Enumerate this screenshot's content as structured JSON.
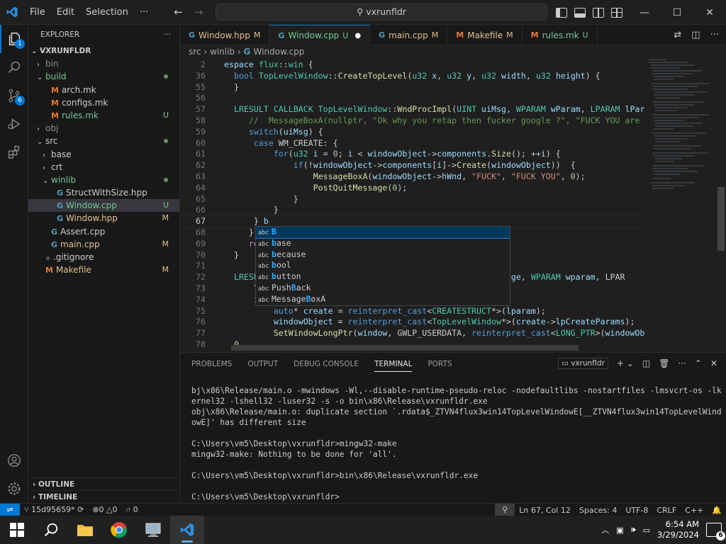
{
  "app": {
    "menu": [
      "File",
      "Edit",
      "Selection"
    ],
    "more": "···",
    "search": "vxrunfldr",
    "accent": "#0078d4"
  },
  "activity": {
    "explorer_badge": "1"
  },
  "explorer": {
    "title": "EXPLORER",
    "root": "VXRUNFLDR",
    "items": [
      {
        "label": "bin",
        "depth": 1,
        "chev": "›",
        "cls": "dim",
        "mark": ""
      },
      {
        "label": "build",
        "depth": 1,
        "chev": "⌄",
        "cls": "u-color",
        "mark": "dot"
      },
      {
        "label": "arch.mk",
        "depth": 2,
        "chev": "",
        "cls": "",
        "mark": "",
        "icon": "M"
      },
      {
        "label": "configs.mk",
        "depth": 2,
        "chev": "",
        "cls": "",
        "mark": "",
        "icon": "M"
      },
      {
        "label": "rules.mk",
        "depth": 2,
        "chev": "",
        "cls": "u-color",
        "mark": "U",
        "icon": "M"
      },
      {
        "label": "obj",
        "depth": 1,
        "chev": "›",
        "cls": "dim",
        "mark": ""
      },
      {
        "label": "src",
        "depth": 1,
        "chev": "⌄",
        "cls": "",
        "mark": "dot"
      },
      {
        "label": "base",
        "depth": 2,
        "chev": "›",
        "cls": "",
        "mark": ""
      },
      {
        "label": "crt",
        "depth": 2,
        "chev": "›",
        "cls": "",
        "mark": ""
      },
      {
        "label": "winlib",
        "depth": 2,
        "chev": "⌄",
        "cls": "u-color",
        "mark": "dot"
      },
      {
        "label": "StructWithSize.hpp",
        "depth": 3,
        "chev": "",
        "cls": "",
        "mark": "",
        "icon": "C"
      },
      {
        "label": "Window.cpp",
        "depth": 3,
        "chev": "",
        "cls": "u-color",
        "mark": "U",
        "icon": "C",
        "sel": true
      },
      {
        "label": "Window.hpp",
        "depth": 3,
        "chev": "",
        "cls": "m-color",
        "mark": "M",
        "icon": "C"
      },
      {
        "label": "Assert.cpp",
        "depth": 2,
        "chev": "",
        "cls": "",
        "mark": "",
        "icon": "C"
      },
      {
        "label": "main.cpp",
        "depth": 2,
        "chev": "",
        "cls": "m-color",
        "mark": "M",
        "icon": "C"
      },
      {
        "label": ".gitignore",
        "depth": 1,
        "chev": "",
        "cls": "",
        "mark": "",
        "icon": "◆"
      },
      {
        "label": "Makefile",
        "depth": 1,
        "chev": "",
        "cls": "m-color",
        "mark": "M",
        "icon": "M"
      }
    ],
    "outline": "OUTLINE",
    "timeline": "TIMELINE"
  },
  "tabs": [
    {
      "label": "Window.hpp",
      "mark": "M",
      "icon": "C"
    },
    {
      "label": "Window.cpp",
      "mark": "U",
      "icon": "C",
      "active": true
    },
    {
      "label": "main.cpp",
      "mark": "M",
      "icon": "C"
    },
    {
      "label": "Makefile",
      "mark": "M",
      "icon": "M"
    },
    {
      "label": "rules.mk",
      "mark": "U",
      "icon": "M"
    }
  ],
  "breadcrumb": {
    "a": "src",
    "b": "winlib",
    "c": "Window.cpp"
  },
  "editor": {
    "lines": [
      {
        "n": "2",
        "t": "espace flux::win {"
      },
      {
        "n": "36",
        "t": "  bool TopLevelWindow::CreateTopLevel(u32 x, u32 y, u32 width, u32 height) {"
      },
      {
        "n": "55",
        "t": "  }"
      },
      {
        "n": "56",
        "t": ""
      },
      {
        "n": "57",
        "t": "  LRESULT CALLBACK TopLevelWindow::WndProcImpl(UINT uiMsg, WPARAM wParam, LPARAM lParam) {"
      },
      {
        "n": "58",
        "t": "     //  MessageBoxA(nullptr, \"Ok why you retap then fucker google ?\", \"FUCK YOU are fuckest go"
      },
      {
        "n": "59",
        "t": "     switch(uiMsg) {"
      },
      {
        "n": "60",
        "t": "      case WM_CREATE: {"
      },
      {
        "n": "61",
        "t": "          for(u32 i = 0; i < windowObject->components.Size(); ++i) {"
      },
      {
        "n": "62",
        "t": "              if(!windowObject->components[i]->Create(windowObject))  {"
      },
      {
        "n": "63",
        "t": "                  MessageBoxA(windowObject->hWnd, \"FUCK\", \"FUCK YOU\", 0);"
      },
      {
        "n": "64",
        "t": "                  PostQuitMessage(0);"
      },
      {
        "n": "65",
        "t": "              }"
      },
      {
        "n": "66",
        "t": "          }"
      },
      {
        "n": "67",
        "t": "      } b",
        "cur": true
      },
      {
        "n": "68",
        "t": "     }"
      },
      {
        "n": "69",
        "t": "     ret"
      },
      {
        "n": "70",
        "t": "  }"
      },
      {
        "n": "71",
        "t": ""
      },
      {
        "n": "72",
        "t": "  LRESULT                                          T message, WPARAM wparam, LPAR"
      },
      {
        "n": "73",
        "t": "      Top"
      },
      {
        "n": "74",
        "t": "      if("
      },
      {
        "n": "75",
        "t": "          auto* create = reinterpret_cast<CREATESTRUCT*>(lparam);"
      },
      {
        "n": "76",
        "t": "          windowObject = reinterpret_cast<TopLevelWindow*>(create->lpCreateParams);"
      },
      {
        "n": "77",
        "t": "          SetWindowLongPtr(window, GWLP_USERDATA, reinterpret_cast<LONG_PTR>(windowObject));"
      },
      {
        "n": "78",
        "t": "  0"
      }
    ],
    "suggestions": [
      {
        "kind": "abc",
        "hl": "B",
        "rest": "",
        "sel": true
      },
      {
        "kind": "abc",
        "hl": "b",
        "rest": "ase"
      },
      {
        "kind": "abc",
        "hl": "b",
        "rest": "ecause"
      },
      {
        "kind": "abc",
        "hl": "b",
        "rest": "ool"
      },
      {
        "kind": "abc",
        "hl": "b",
        "rest": "utton"
      },
      {
        "kind": "abc",
        "pre": "Push",
        "hl": "B",
        "rest": "ack"
      },
      {
        "kind": "abc",
        "pre": "Message",
        "hl": "B",
        "rest": "oxA"
      }
    ]
  },
  "panel": {
    "tabs": [
      "PROBLEMS",
      "OUTPUT",
      "DEBUG CONSOLE",
      "TERMINAL",
      "PORTS"
    ],
    "active": "TERMINAL",
    "terminal_name": "vxrunfldr",
    "terminal_text": "bj\\x86\\Release/main.o -mwindows -Wl,--disable-runtime-pseudo-reloc -nodefaultlibs -nostartfiles -lmsvcrt-os -lkernel32 -lshell32 -luser32 -s -o bin\\x86\\Release\\vxrunfldr.exe\nobj\\x86\\Release/main.o: duplicate section `.rdata$_ZTVN4flux3win14TopLevelWindowE[__ZTVN4flux3win14TopLevelWindowE]' has different size\n\nC:\\Users\\vm5\\Desktop\\vxrunfldr>mingw32-make\nmingw32-make: Nothing to be done for 'all'.\n\nC:\\Users\\vm5\\Desktop\\vxrunfldr>bin\\x86\\Release\\vxrunfldr.exe\n\nC:\\Users\\vm5\\Desktop\\vxrunfldr>"
  },
  "status": {
    "branch": "15d95659*",
    "errors": "0",
    "warnings": "0",
    "ports": "0",
    "position": "Ln 67, Col 12",
    "spaces": "Spaces: 4",
    "encoding": "UTF-8",
    "eol": "CRLF",
    "language": "C++"
  },
  "taskbar": {
    "time": "6:54 AM",
    "date": "3/29/2024",
    "notifications": "6"
  }
}
